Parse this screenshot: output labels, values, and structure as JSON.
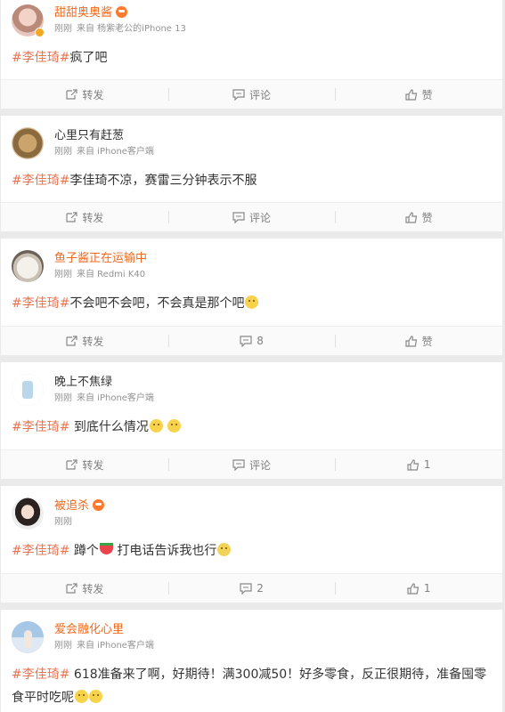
{
  "labels": {
    "forward": "转发",
    "comment": "评论",
    "like": "赞"
  },
  "posts": [
    {
      "user": "甜甜奥奥酱",
      "time": "刚刚",
      "source": "来自 杨紫老公的iPhone 13",
      "topic": "#李佳琦#",
      "text": "疯了吧",
      "comment": "评论",
      "like": "赞"
    },
    {
      "user": "心里只有赶葱",
      "time": "刚刚",
      "source": "来自 iPhone客户端",
      "topic": "#李佳琦#",
      "text": "李佳琦不凉，赛雷三分钟表示不服",
      "comment": "评论",
      "like": "赞"
    },
    {
      "user": "鱼子酱正在运输中",
      "time": "刚刚",
      "source": "来自 Redmi K40",
      "topic": "#李佳琦#",
      "text": "不会吧不会吧，不会真是那个吧",
      "comment": "8",
      "like": "赞"
    },
    {
      "user": "晚上不焦绿",
      "time": "刚刚",
      "source": "来自 iPhone客户端",
      "topic": "#李佳琦#",
      "text": " 到底什么情况",
      "comment": "评论",
      "like": "1"
    },
    {
      "user": "被追杀",
      "time": "刚刚",
      "source": "",
      "topic": "#李佳琦#",
      "text": " 蹲个",
      "text2": " 打电话告诉我也行",
      "comment": "2",
      "like": "1"
    },
    {
      "user": "爱会融化心里",
      "time": "刚刚",
      "source": "来自 iPhone客户端",
      "topic": "#李佳琦#",
      "text": " 618准备来了啊，好期待！满300减50！好多零食，反正很期待，准备囤零食平时吃呢"
    }
  ]
}
